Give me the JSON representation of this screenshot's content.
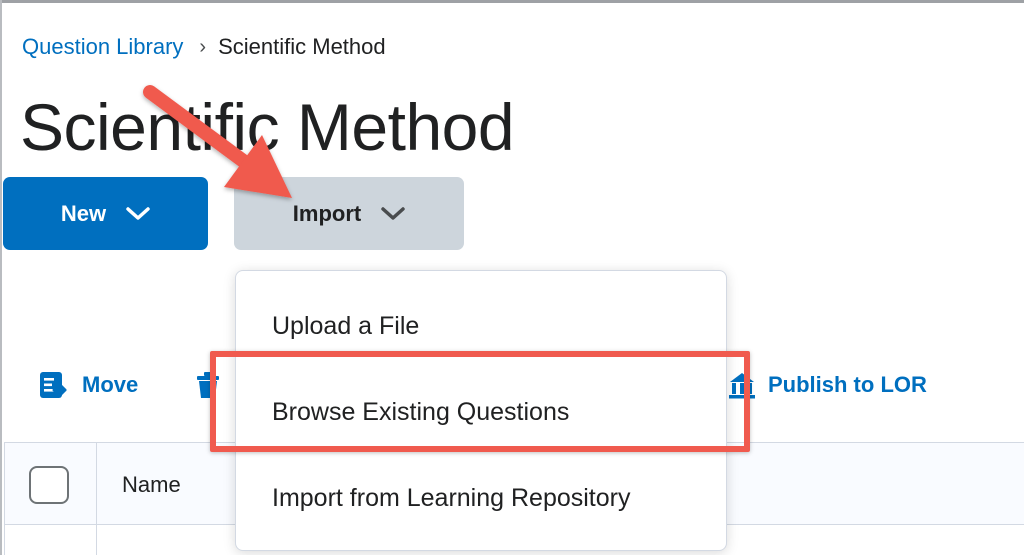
{
  "breadcrumb": {
    "parent": "Question Library",
    "separator": "›",
    "current": "Scientific Method"
  },
  "page": {
    "title": "Scientific Method"
  },
  "actions": {
    "new_label": "New",
    "import_label": "Import"
  },
  "toolbar": {
    "move_label": "Move",
    "publish_label": "Publish to LOR"
  },
  "import_menu": {
    "items": [
      {
        "label": "Upload a File"
      },
      {
        "label": "Browse Existing Questions"
      },
      {
        "label": "Import from Learning Repository"
      }
    ]
  },
  "table": {
    "columns": [
      {
        "label": "Name"
      }
    ]
  },
  "colors": {
    "primary": "#006fbf",
    "secondary_button": "#cdd5dc",
    "annotation_red": "#f05a4e"
  },
  "icons": {
    "new_chevron": "chevron-down-icon",
    "import_chevron": "chevron-down-icon",
    "move": "move-icon",
    "delete": "trash-icon",
    "publish": "publish-icon"
  }
}
